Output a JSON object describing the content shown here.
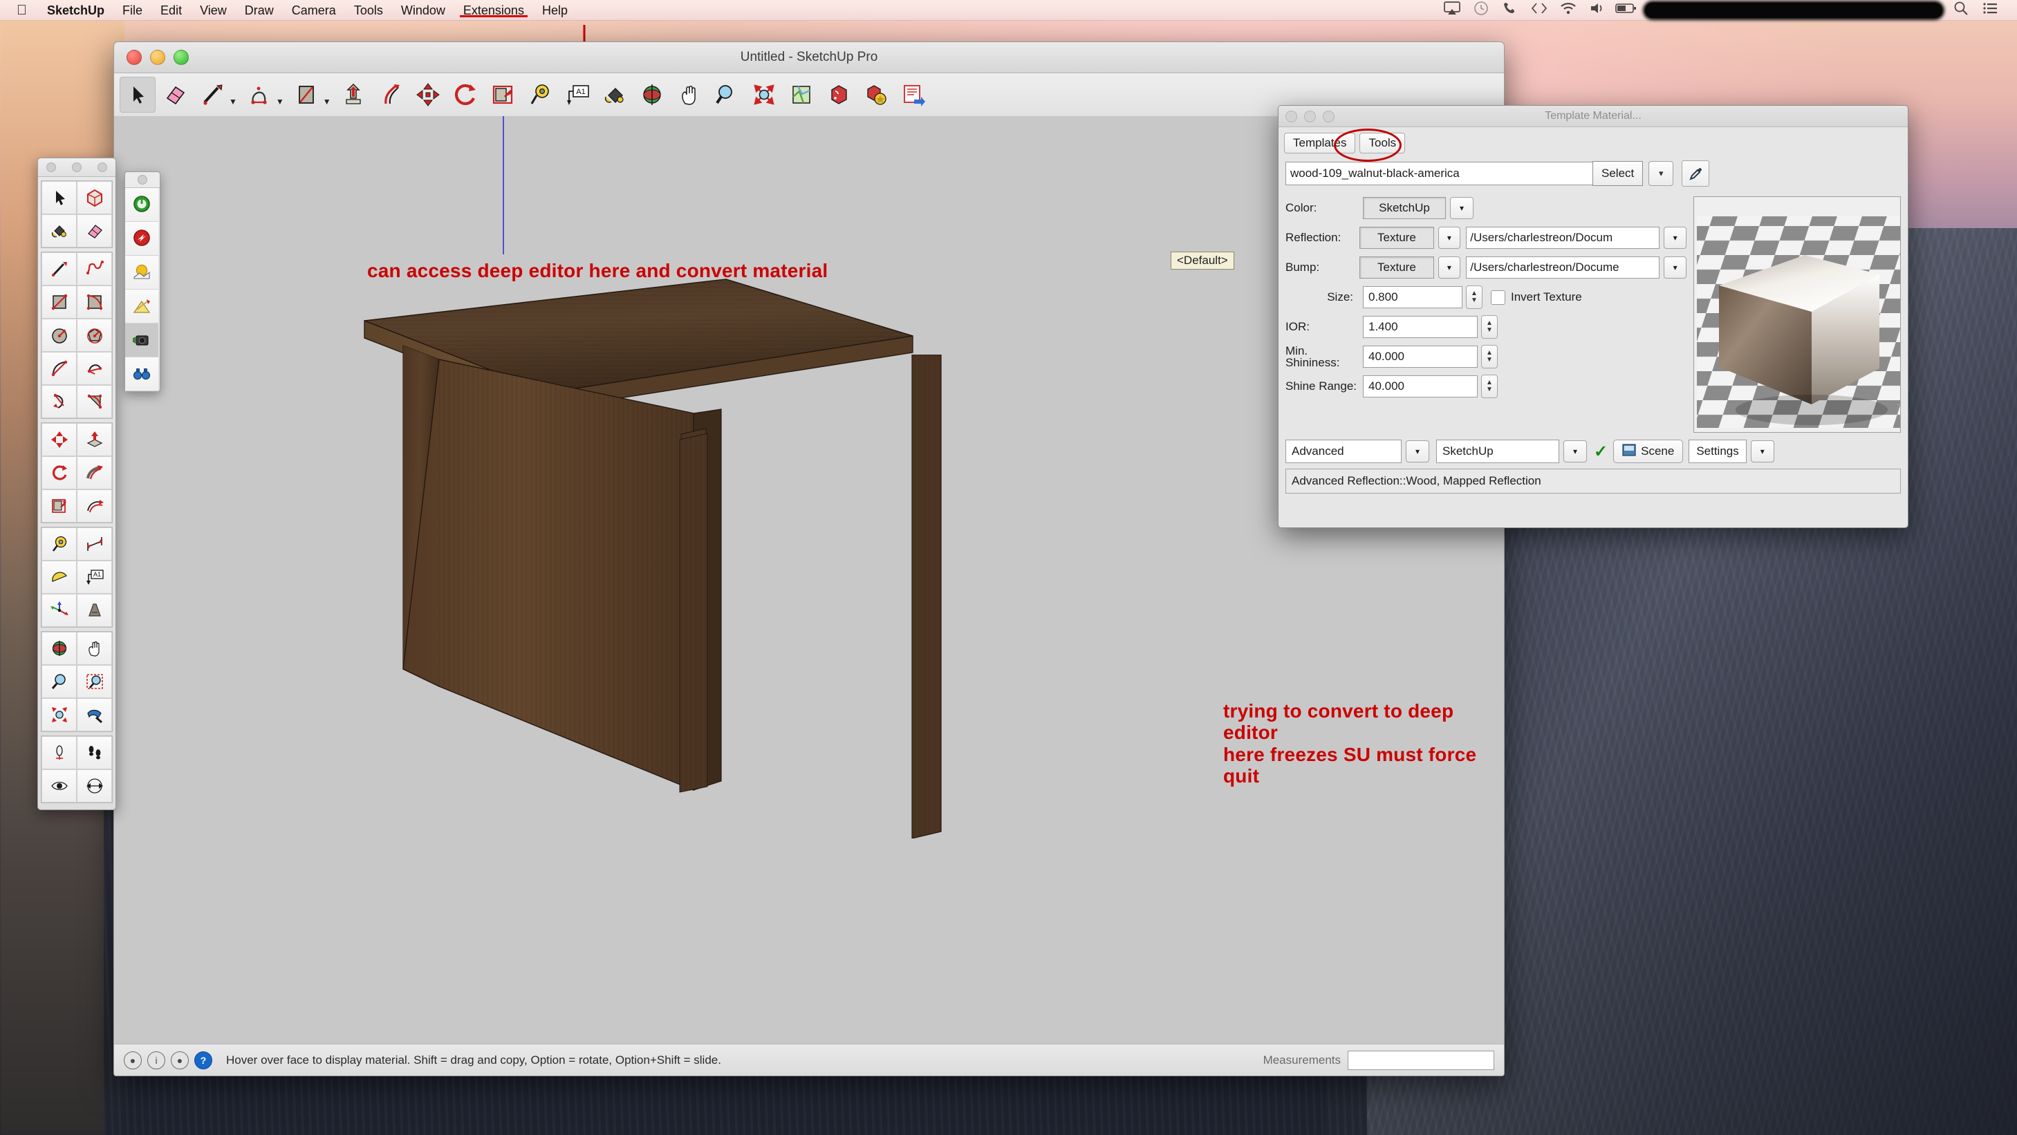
{
  "menubar": {
    "apple": "apple-logo",
    "items": [
      {
        "label": "SketchUp",
        "bold": true,
        "active": false
      },
      {
        "label": "File",
        "bold": false,
        "active": false
      },
      {
        "label": "Edit",
        "bold": false,
        "active": false
      },
      {
        "label": "View",
        "bold": false,
        "active": false
      },
      {
        "label": "Draw",
        "bold": false,
        "active": false
      },
      {
        "label": "Camera",
        "bold": false,
        "active": false
      },
      {
        "label": "Tools",
        "bold": false,
        "active": false
      },
      {
        "label": "Window",
        "bold": false,
        "active": false
      },
      {
        "label": "Extensions",
        "bold": false,
        "active": true
      },
      {
        "label": "Help",
        "bold": false,
        "active": false
      }
    ],
    "status_icons": [
      "airplay-icon",
      "time-machine-icon",
      "phone-icon",
      "code-icon",
      "wifi-icon",
      "volume-icon",
      "battery-icon"
    ],
    "redaction": "redacted-block",
    "search_icon": "search-icon",
    "list_icon": "notification-center-icon"
  },
  "window": {
    "title": "Untitled - SketchUp Pro",
    "traffic": [
      "close-button",
      "minimize-button",
      "zoom-button"
    ]
  },
  "toolbar": {
    "tools": [
      {
        "name": "select-tool",
        "selected": true
      },
      {
        "name": "eraser-tool",
        "selected": false
      },
      {
        "name": "line-tool",
        "selected": false,
        "caret": true
      },
      {
        "name": "arc-tool",
        "selected": false,
        "caret": true
      },
      {
        "name": "rectangle-tool",
        "selected": false,
        "caret": true
      },
      {
        "name": "pushpull-tool",
        "selected": false
      },
      {
        "name": "followme-tool",
        "selected": false
      },
      {
        "name": "move-tool",
        "selected": false
      },
      {
        "name": "rotate-tool",
        "selected": false
      },
      {
        "name": "offset-tool",
        "selected": false
      },
      {
        "name": "tape-measure-tool",
        "selected": false
      },
      {
        "name": "text-tool",
        "selected": false
      },
      {
        "name": "paint-bucket-tool",
        "selected": false
      },
      {
        "name": "orbit-tool",
        "selected": false
      },
      {
        "name": "pan-tool",
        "selected": false
      },
      {
        "name": "zoom-tool",
        "selected": false
      },
      {
        "name": "zoom-extents-tool",
        "selected": false
      },
      {
        "name": "add-location-tool",
        "selected": false
      },
      {
        "name": "3d-warehouse-tool",
        "selected": false
      },
      {
        "name": "extension-warehouse-tool",
        "selected": false
      },
      {
        "name": "share-model-tool",
        "selected": false
      }
    ]
  },
  "canvas": {
    "default_tag": "<Default>",
    "model_description": "wood table 3d model"
  },
  "annotations": [
    {
      "id": "annot-access",
      "lines": [
        "can access deep editor here and convert material"
      ]
    },
    {
      "id": "annot-freeze",
      "lines": [
        "trying to convert to deep editor",
        "here freezes SU must force quit"
      ]
    }
  ],
  "statusbar": {
    "icons": [
      "location-icon",
      "info-icon",
      "person-icon",
      "help-icon"
    ],
    "hint": "Hover over face to display material. Shift = drag and copy, Option = rotate, Option+Shift = slide.",
    "measurements_label": "Measurements",
    "measurements_value": ""
  },
  "tool_palette": {
    "groups": [
      {
        "items": [
          {
            "name": "select-tool",
            "selected": false
          },
          {
            "name": "make-component-tool",
            "selected": false
          },
          {
            "name": "paint-bucket-tool",
            "selected": false
          },
          {
            "name": "eraser-tool",
            "selected": false
          }
        ]
      },
      {
        "items": [
          {
            "name": "line-tool",
            "selected": false
          },
          {
            "name": "freehand-tool",
            "selected": false
          },
          {
            "name": "rectangle-tool",
            "selected": false
          },
          {
            "name": "rotated-rectangle-tool",
            "selected": false
          },
          {
            "name": "circle-tool",
            "selected": false
          },
          {
            "name": "polygon-tool",
            "selected": false
          },
          {
            "name": "arc-tool",
            "selected": false
          },
          {
            "name": "two-point-arc-tool",
            "selected": false
          },
          {
            "name": "three-point-arc-tool",
            "selected": false
          },
          {
            "name": "pie-tool",
            "selected": false
          }
        ]
      },
      {
        "items": [
          {
            "name": "move-tool",
            "selected": false
          },
          {
            "name": "pushpull-tool",
            "selected": false
          },
          {
            "name": "rotate-tool",
            "selected": false
          },
          {
            "name": "followme-tool",
            "selected": false
          },
          {
            "name": "scale-tool",
            "selected": false
          },
          {
            "name": "offset-tool",
            "selected": false
          }
        ]
      },
      {
        "items": [
          {
            "name": "tape-measure-tool",
            "selected": false
          },
          {
            "name": "dimension-tool",
            "selected": false
          },
          {
            "name": "protractor-tool",
            "selected": false
          },
          {
            "name": "text-tool",
            "selected": false
          },
          {
            "name": "axes-tool",
            "selected": false
          },
          {
            "name": "3d-text-tool",
            "selected": false
          }
        ]
      },
      {
        "items": [
          {
            "name": "orbit-tool",
            "selected": false
          },
          {
            "name": "pan-tool",
            "selected": false
          },
          {
            "name": "zoom-tool",
            "selected": false
          },
          {
            "name": "zoom-window-tool",
            "selected": false
          },
          {
            "name": "zoom-extents-tool",
            "selected": false
          },
          {
            "name": "previous-view-tool",
            "selected": false
          }
        ]
      },
      {
        "items": [
          {
            "name": "position-camera-tool",
            "selected": false
          },
          {
            "name": "walk-tool",
            "selected": false
          },
          {
            "name": "look-around-tool",
            "selected": false
          },
          {
            "name": "section-plane-tool",
            "selected": false
          }
        ]
      }
    ]
  },
  "render_palette": {
    "items": [
      {
        "name": "render-start-icon",
        "selected": false
      },
      {
        "name": "render-stop-icon",
        "selected": false
      },
      {
        "name": "sun-light-icon",
        "selected": false
      },
      {
        "name": "material-editor-icon",
        "selected": false
      },
      {
        "name": "camera-settings-icon",
        "selected": true
      },
      {
        "name": "view-options-icon",
        "selected": false
      }
    ]
  },
  "material_dialog": {
    "title": "Template Material...",
    "traffic": [
      "close-button",
      "minimize-button",
      "zoom-button"
    ],
    "tabs": [
      {
        "label": "Templates",
        "name": "tab-templates",
        "active": false
      },
      {
        "label": "Tools",
        "name": "tab-tools",
        "active": true
      }
    ],
    "material_name": "wood-109_walnut-black-america",
    "select_button": "Select",
    "eyedropper": "eyedropper-icon",
    "fields": [
      {
        "label": "Color:",
        "value": "SketchUp",
        "type": "combo",
        "name": "color-field"
      },
      {
        "label": "Reflection:",
        "value": "Texture",
        "path": "/Users/charlestreon/Docum",
        "type": "combo-path",
        "name": "reflection-field"
      },
      {
        "label": "Bump:",
        "value": "Texture",
        "path": "/Users/charlestreon/Docume",
        "type": "combo-path",
        "name": "bump-field"
      },
      {
        "label": "Size:",
        "value": "0.800",
        "type": "stepper",
        "name": "size-field",
        "checkbox": "Invert Texture",
        "checked": false
      },
      {
        "label": "IOR:",
        "value": "1.400",
        "type": "stepper",
        "name": "ior-field"
      },
      {
        "label": "Min. Shininess:",
        "value": "40.000",
        "type": "stepper",
        "name": "min-shininess-field"
      },
      {
        "label": "Shine Range:",
        "value": "40.000",
        "type": "stepper",
        "name": "shine-range-field"
      }
    ],
    "labels": {
      "color": "Color:",
      "reflection": "Reflection:",
      "bump": "Bump:",
      "size": "Size:",
      "invert_texture": "Invert Texture",
      "ior": "IOR:",
      "min_shininess_l1": "Min.",
      "min_shininess_l2": "Shininess:",
      "shine_range": "Shine Range:"
    },
    "values": {
      "color": "SketchUp",
      "reflection": "Texture",
      "reflection_path": "/Users/charlestreon/Docum",
      "bump": "Texture",
      "bump_path": "/Users/charlestreon/Docume",
      "size": "0.800",
      "ior": "1.400",
      "min_shininess": "40.000",
      "shine_range": "40.000"
    },
    "bottom": {
      "preset": "Advanced",
      "engine": "SketchUp",
      "apply_icon": "green-check-icon",
      "scene_button": "Scene",
      "scene_icon": "scene-icon",
      "settings": "Settings"
    },
    "status": "Advanced Reflection::Wood, Mapped Reflection",
    "preview_alt": "material-preview-cube"
  },
  "colors": {
    "annotation_red": "#cc0000",
    "menu_underline": "#d80000",
    "canvas_bg": "#c8c8c8",
    "wood_dark": "#4a3322",
    "wood_light": "#6d4c30",
    "axis_blue": "#3b3bd0",
    "green_check": "#128a12"
  }
}
